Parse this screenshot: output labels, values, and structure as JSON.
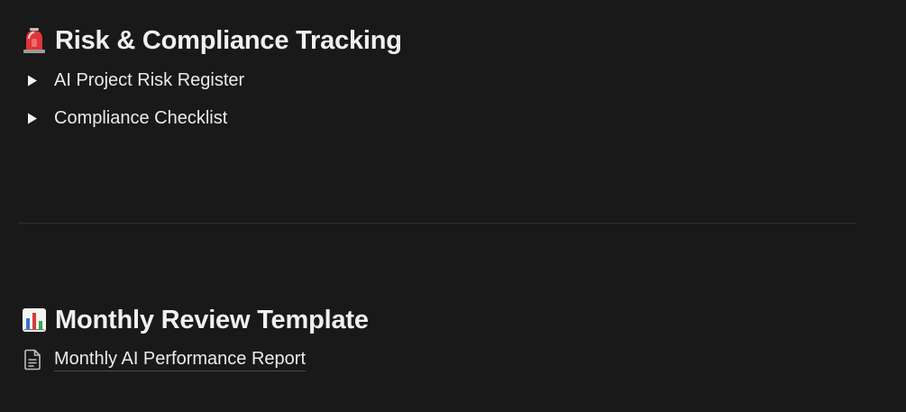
{
  "sections": {
    "risk": {
      "icon": "police-light-icon",
      "title": "Risk & Compliance Tracking",
      "toggles": [
        {
          "label": "AI Project Risk Register",
          "icon": "toggle-arrow-icon"
        },
        {
          "label": "Compliance Checklist",
          "icon": "toggle-arrow-icon"
        }
      ]
    },
    "monthly": {
      "icon": "bar-chart-icon",
      "title": "Monthly Review Template",
      "page_link": {
        "label": "Monthly AI Performance Report",
        "icon": "document-icon"
      }
    }
  },
  "colors": {
    "background": "#191919",
    "text": "#e8e8e6",
    "divider": "#2f2f2f",
    "siren_red": "#e0333a",
    "chart_blue": "#3b6fd6",
    "chart_green": "#3aa34a",
    "chart_red": "#d83a3a"
  }
}
